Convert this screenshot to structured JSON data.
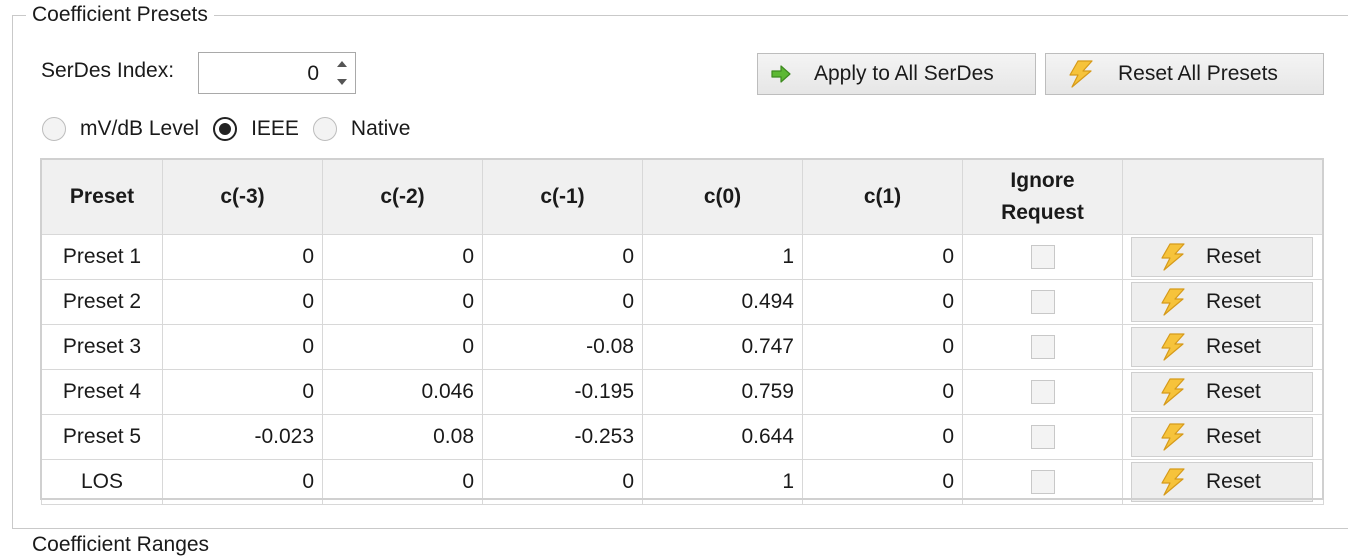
{
  "group_title": "Coefficient Presets",
  "next_group_title": "Coefficient Ranges",
  "serdes": {
    "label": "SerDes Index:",
    "value": "0"
  },
  "buttons": {
    "apply_all": "Apply to All SerDes",
    "reset_all": "Reset All Presets"
  },
  "radio": {
    "options": [
      "mV/dB Level",
      "IEEE",
      "Native"
    ],
    "selected": "IEEE"
  },
  "table": {
    "headers": [
      "Preset",
      "c(-3)",
      "c(-2)",
      "c(-1)",
      "c(0)",
      "c(1)",
      "Ignore",
      "Request",
      ""
    ],
    "row_action_label": "Reset",
    "rows": [
      {
        "name": "Preset 1",
        "c_m3": "0",
        "c_m2": "0",
        "c_m1": "0",
        "c0": "1",
        "c1": "0",
        "ignore": false
      },
      {
        "name": "Preset 2",
        "c_m3": "0",
        "c_m2": "0",
        "c_m1": "0",
        "c0": "0.494",
        "c1": "0",
        "ignore": false
      },
      {
        "name": "Preset 3",
        "c_m3": "0",
        "c_m2": "0",
        "c_m1": "-0.08",
        "c0": "0.747",
        "c1": "0",
        "ignore": false
      },
      {
        "name": "Preset 4",
        "c_m3": "0",
        "c_m2": "0.046",
        "c_m1": "-0.195",
        "c0": "0.759",
        "c1": "0",
        "ignore": false
      },
      {
        "name": "Preset 5",
        "c_m3": "-0.023",
        "c_m2": "0.08",
        "c_m1": "-0.253",
        "c0": "0.644",
        "c1": "0",
        "ignore": false
      },
      {
        "name": "LOS",
        "c_m3": "0",
        "c_m2": "0",
        "c_m1": "0",
        "c0": "1",
        "c1": "0",
        "ignore": false
      }
    ]
  },
  "icons": {
    "apply": "green-arrow-right-icon",
    "reset": "lightning-bolt-icon"
  },
  "colors": {
    "arrow_green": "#4caf2a",
    "bolt_yellow": "#f6c33b",
    "header_bg": "#f0f0f0"
  }
}
